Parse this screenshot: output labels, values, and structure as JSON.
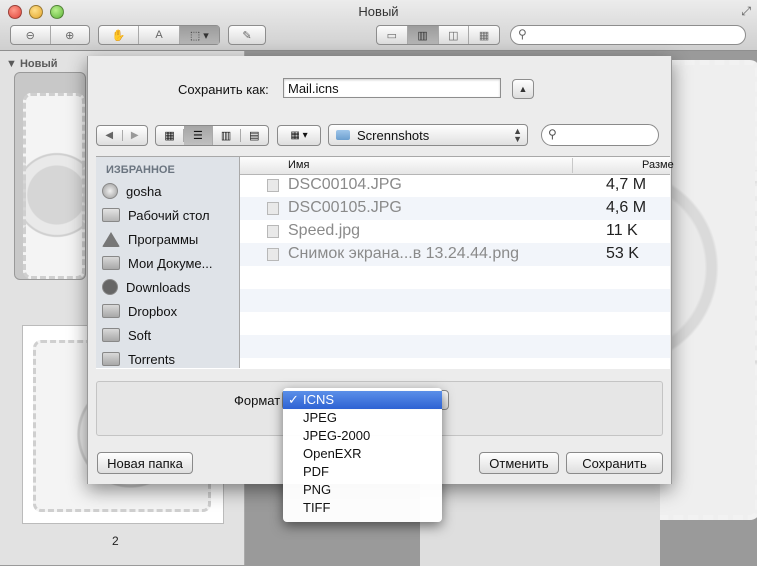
{
  "window": {
    "title": "Новый",
    "fullscreen_icon": "⤢"
  },
  "toolbar": {
    "zoom_group": [
      "⊖",
      "⊕"
    ],
    "tool_group": [
      "✋",
      "A",
      "⬚ ▾"
    ],
    "annotate": "✎",
    "view_group": [
      "▭",
      "▥",
      "◫",
      "▦"
    ],
    "search_placeholder": "",
    "search_icon": "search-icon"
  },
  "sidebar": {
    "header": "▼ Новый",
    "page_number": "2"
  },
  "sheet": {
    "save_as_label": "Сохранить как:",
    "filename": "Mail.icns",
    "disclosure": "▲",
    "nav": [
      "◀",
      "▶"
    ],
    "views": [
      "▦",
      "☰",
      "▥",
      "▤"
    ],
    "arrange": "▦ ▾",
    "location": "Scrennshots",
    "location_arrows": "▲\n▼",
    "search_placeholder": "",
    "favorites_header": "ИЗБРАННОЕ",
    "favorites": [
      {
        "label": "gosha",
        "icon": "home-icon"
      },
      {
        "label": "Рабочий стол",
        "icon": "desktop-icon"
      },
      {
        "label": "Программы",
        "icon": "applications-icon"
      },
      {
        "label": "Мои Докуме...",
        "icon": "folder-icon"
      },
      {
        "label": "Downloads",
        "icon": "downloads-icon"
      },
      {
        "label": "Dropbox",
        "icon": "folder-icon"
      },
      {
        "label": "Soft",
        "icon": "folder-icon"
      },
      {
        "label": "Torrents",
        "icon": "folder-icon"
      }
    ],
    "columns": {
      "name": "Имя",
      "size": "Разме"
    },
    "files": [
      {
        "name": "DSC00104.JPG",
        "size": "4,7 M"
      },
      {
        "name": "DSC00105.JPG",
        "size": "4,6 M"
      },
      {
        "name": "Speed.jpg",
        "size": "11 K"
      },
      {
        "name": "Снимок экрана...в 13.24.44.png",
        "size": "53 K"
      }
    ],
    "format_label": "Формат",
    "format_value": "ICNS",
    "buttons": {
      "new_folder": "Новая папка",
      "cancel": "Отменить",
      "save": "Сохранить"
    }
  },
  "format_menu": {
    "checkmark": "✓",
    "selected_index": 0,
    "options": [
      "ICNS",
      "JPEG",
      "JPEG-2000",
      "OpenEXR",
      "PDF",
      "PNG",
      "TIFF"
    ]
  }
}
